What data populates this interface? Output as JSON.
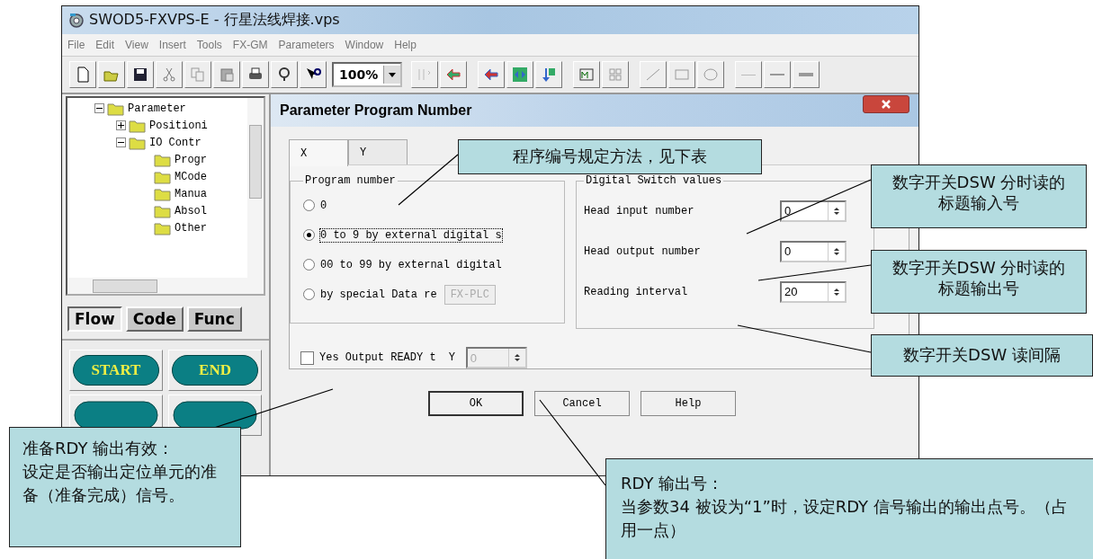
{
  "window": {
    "title": "SWOD5-FXVPS-E - 行星法线焊接.vps"
  },
  "menu": [
    "File",
    "Edit",
    "View",
    "Insert",
    "Tools",
    "FX-GM",
    "Parameters",
    "Window",
    "Help"
  ],
  "toolbar": {
    "zoom": "100%"
  },
  "tree": [
    {
      "label": "Parameter",
      "expanded": true,
      "children": [
        {
          "label": "Positioni",
          "expanded": false
        },
        {
          "label": "IO Contr",
          "expanded": true,
          "children": [
            {
              "label": "Progr"
            },
            {
              "label": "MCode"
            },
            {
              "label": "Manua"
            },
            {
              "label": "Absol"
            },
            {
              "label": "Other"
            }
          ]
        }
      ]
    }
  ],
  "palette_tabs": [
    {
      "label": "Flow",
      "selected": true
    },
    {
      "label": "Code",
      "selected": false
    },
    {
      "label": "Func",
      "selected": false
    }
  ],
  "palette_buttons": [
    "START",
    "END"
  ],
  "dialog": {
    "title": "Parameter Program Number",
    "tabs": [
      {
        "label": "X",
        "selected": true
      },
      {
        "label": "Y",
        "selected": false
      }
    ],
    "program_number": {
      "title": "Program number",
      "options": [
        {
          "label": "0",
          "selected": false
        },
        {
          "label": "0 to 9 by external digital s",
          "selected": true
        },
        {
          "label": "00 to 99 by external digital",
          "selected": false
        },
        {
          "label": "by special Data re",
          "selected": false
        }
      ],
      "plc_button": "FX-PLC"
    },
    "digital_switch": {
      "title": "Digital Switch values",
      "fields": [
        {
          "label": "Head input number",
          "value": "0"
        },
        {
          "label": "Head output number",
          "value": "0"
        },
        {
          "label": "Reading interval",
          "value": "20"
        }
      ]
    },
    "ready_output": {
      "label": "Yes Output READY t",
      "checked": false,
      "device": "Y",
      "value": "0",
      "disabled": true
    },
    "buttons": [
      "OK",
      "Cancel",
      "Help"
    ]
  },
  "callouts": [
    {
      "text": "程序编号规定方法，见下表"
    },
    {
      "text": "数字开关DSW 分时读的标题输入号"
    },
    {
      "text": "数字开关DSW 分时读的标题输出号"
    },
    {
      "text": "数字开关DSW 读间隔"
    },
    {
      "title": "准备RDY 输出有效：",
      "text": "设定是否输出定位单元的准备（准备完成）信号。"
    },
    {
      "title": "RDY 输出号：",
      "text": "当参数34 被设为“1”时，设定RDY 信号输出的输出点号。（占用一点）"
    }
  ]
}
